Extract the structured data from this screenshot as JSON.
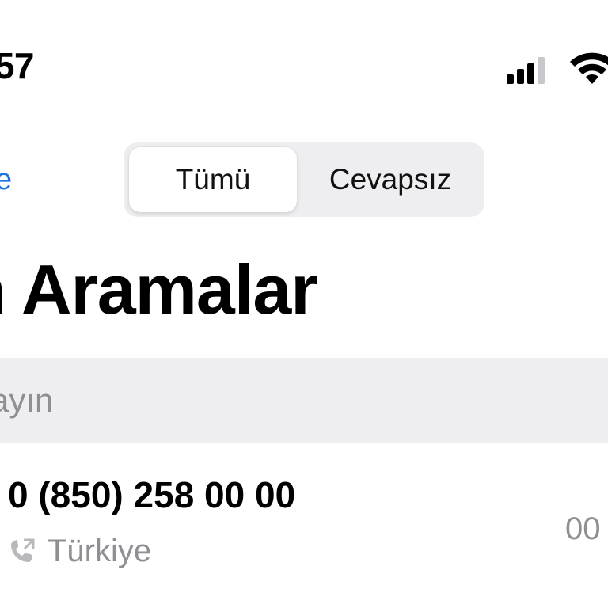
{
  "status_bar": {
    "time": ":57",
    "icons": [
      "cellular-signal-icon",
      "wifi-icon"
    ]
  },
  "nav": {
    "edit_label": "e",
    "segments": [
      {
        "label": "Tümü",
        "selected": true
      },
      {
        "label": "Cevapsız",
        "selected": false
      }
    ]
  },
  "title": "n Aramalar",
  "search": {
    "placeholder": "ayın"
  },
  "calls": [
    {
      "number": "0 (850) 258 00 00",
      "location": "Türkiye",
      "time": "00",
      "icon": "outgoing-call-icon"
    }
  ],
  "colors": {
    "accent": "#1a73e8",
    "secondary_text": "#8e8e93",
    "segment_bg": "#eeeef0"
  }
}
